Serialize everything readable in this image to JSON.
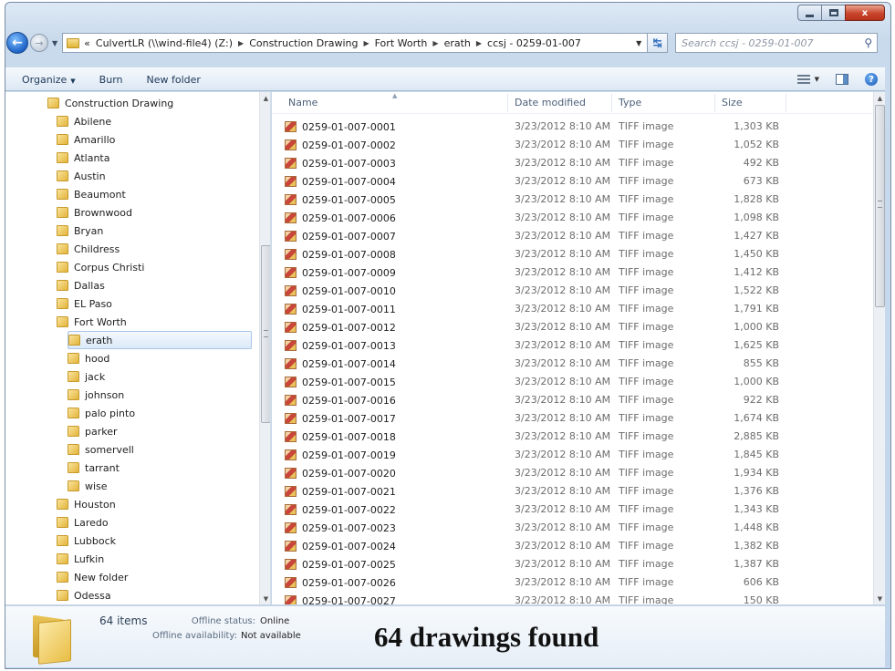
{
  "window": {
    "icons": [
      "minimize-icon",
      "maximize-icon",
      "close-icon"
    ],
    "close_glyph": "x"
  },
  "address": {
    "overflow": "«",
    "crumbs": [
      "CulvertLR (\\\\wind-file4) (Z:)",
      "Construction Drawing",
      "Fort Worth",
      "erath",
      "ccsj - 0259-01-007"
    ]
  },
  "search": {
    "placeholder": "Search ccsj - 0259-01-007"
  },
  "toolbar": {
    "organize": "Organize",
    "burn": "Burn",
    "new_folder": "New folder"
  },
  "nav": {
    "items": [
      {
        "label": "Construction Drawing",
        "level": 0
      },
      {
        "label": "Abilene",
        "level": 1
      },
      {
        "label": "Amarillo",
        "level": 1
      },
      {
        "label": "Atlanta",
        "level": 1
      },
      {
        "label": "Austin",
        "level": 1
      },
      {
        "label": "Beaumont",
        "level": 1
      },
      {
        "label": "Brownwood",
        "level": 1
      },
      {
        "label": "Bryan",
        "level": 1
      },
      {
        "label": "Childress",
        "level": 1
      },
      {
        "label": "Corpus Christi",
        "level": 1
      },
      {
        "label": "Dallas",
        "level": 1
      },
      {
        "label": "EL Paso",
        "level": 1
      },
      {
        "label": "Fort Worth",
        "level": 1
      },
      {
        "label": "erath",
        "level": 2,
        "selected": true
      },
      {
        "label": "hood",
        "level": 2
      },
      {
        "label": "jack",
        "level": 2
      },
      {
        "label": "johnson",
        "level": 2
      },
      {
        "label": "palo pinto",
        "level": 2
      },
      {
        "label": "parker",
        "level": 2
      },
      {
        "label": "somervell",
        "level": 2
      },
      {
        "label": "tarrant",
        "level": 2
      },
      {
        "label": "wise",
        "level": 2
      },
      {
        "label": "Houston",
        "level": 1
      },
      {
        "label": "Laredo",
        "level": 1
      },
      {
        "label": "Lubbock",
        "level": 1
      },
      {
        "label": "Lufkin",
        "level": 1
      },
      {
        "label": "New folder",
        "level": 1
      },
      {
        "label": "Odessa",
        "level": 1
      }
    ]
  },
  "columns": {
    "name": "Name",
    "date": "Date modified",
    "type": "Type",
    "size": "Size"
  },
  "files": [
    {
      "name": "0259-01-007-0001",
      "date": "3/23/2012 8:10 AM",
      "type": "TIFF image",
      "size": "1,303 KB"
    },
    {
      "name": "0259-01-007-0002",
      "date": "3/23/2012 8:10 AM",
      "type": "TIFF image",
      "size": "1,052 KB"
    },
    {
      "name": "0259-01-007-0003",
      "date": "3/23/2012 8:10 AM",
      "type": "TIFF image",
      "size": "492 KB"
    },
    {
      "name": "0259-01-007-0004",
      "date": "3/23/2012 8:10 AM",
      "type": "TIFF image",
      "size": "673 KB"
    },
    {
      "name": "0259-01-007-0005",
      "date": "3/23/2012 8:10 AM",
      "type": "TIFF image",
      "size": "1,828 KB"
    },
    {
      "name": "0259-01-007-0006",
      "date": "3/23/2012 8:10 AM",
      "type": "TIFF image",
      "size": "1,098 KB"
    },
    {
      "name": "0259-01-007-0007",
      "date": "3/23/2012 8:10 AM",
      "type": "TIFF image",
      "size": "1,427 KB"
    },
    {
      "name": "0259-01-007-0008",
      "date": "3/23/2012 8:10 AM",
      "type": "TIFF image",
      "size": "1,450 KB"
    },
    {
      "name": "0259-01-007-0009",
      "date": "3/23/2012 8:10 AM",
      "type": "TIFF image",
      "size": "1,412 KB"
    },
    {
      "name": "0259-01-007-0010",
      "date": "3/23/2012 8:10 AM",
      "type": "TIFF image",
      "size": "1,522 KB"
    },
    {
      "name": "0259-01-007-0011",
      "date": "3/23/2012 8:10 AM",
      "type": "TIFF image",
      "size": "1,791 KB"
    },
    {
      "name": "0259-01-007-0012",
      "date": "3/23/2012 8:10 AM",
      "type": "TIFF image",
      "size": "1,000 KB"
    },
    {
      "name": "0259-01-007-0013",
      "date": "3/23/2012 8:10 AM",
      "type": "TIFF image",
      "size": "1,625 KB"
    },
    {
      "name": "0259-01-007-0014",
      "date": "3/23/2012 8:10 AM",
      "type": "TIFF image",
      "size": "855 KB"
    },
    {
      "name": "0259-01-007-0015",
      "date": "3/23/2012 8:10 AM",
      "type": "TIFF image",
      "size": "1,000 KB"
    },
    {
      "name": "0259-01-007-0016",
      "date": "3/23/2012 8:10 AM",
      "type": "TIFF image",
      "size": "922 KB"
    },
    {
      "name": "0259-01-007-0017",
      "date": "3/23/2012 8:10 AM",
      "type": "TIFF image",
      "size": "1,674 KB"
    },
    {
      "name": "0259-01-007-0018",
      "date": "3/23/2012 8:10 AM",
      "type": "TIFF image",
      "size": "2,885 KB"
    },
    {
      "name": "0259-01-007-0019",
      "date": "3/23/2012 8:10 AM",
      "type": "TIFF image",
      "size": "1,845 KB"
    },
    {
      "name": "0259-01-007-0020",
      "date": "3/23/2012 8:10 AM",
      "type": "TIFF image",
      "size": "1,934 KB"
    },
    {
      "name": "0259-01-007-0021",
      "date": "3/23/2012 8:10 AM",
      "type": "TIFF image",
      "size": "1,376 KB"
    },
    {
      "name": "0259-01-007-0022",
      "date": "3/23/2012 8:10 AM",
      "type": "TIFF image",
      "size": "1,343 KB"
    },
    {
      "name": "0259-01-007-0023",
      "date": "3/23/2012 8:10 AM",
      "type": "TIFF image",
      "size": "1,448 KB"
    },
    {
      "name": "0259-01-007-0024",
      "date": "3/23/2012 8:10 AM",
      "type": "TIFF image",
      "size": "1,382 KB"
    },
    {
      "name": "0259-01-007-0025",
      "date": "3/23/2012 8:10 AM",
      "type": "TIFF image",
      "size": "1,387 KB"
    },
    {
      "name": "0259-01-007-0026",
      "date": "3/23/2012 8:10 AM",
      "type": "TIFF image",
      "size": "606 KB"
    },
    {
      "name": "0259-01-007-0027",
      "date": "3/23/2012 8:10 AM",
      "type": "TIFF image",
      "size": "150 KB"
    }
  ],
  "details": {
    "items_count": "64 items",
    "offline_status_label": "Offline status:",
    "offline_status_value": "Online",
    "offline_availability_label": "Offline availability:",
    "offline_availability_value": "Not available"
  },
  "overlay_note": "64 drawings found",
  "colors": {
    "accent": "#1e63c7",
    "folder": "#e3b53b",
    "close": "#c9452c"
  }
}
